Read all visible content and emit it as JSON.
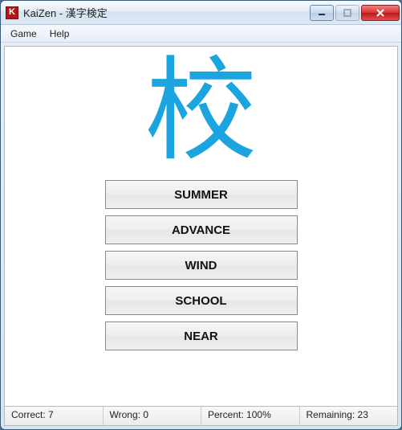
{
  "window": {
    "title": "KaiZen - 漢字検定",
    "app_icon_letter": "K"
  },
  "menu": {
    "game": "Game",
    "help": "Help"
  },
  "quiz": {
    "kanji": "校",
    "answers": [
      "SUMMER",
      "ADVANCE",
      "WIND",
      "SCHOOL",
      "NEAR"
    ]
  },
  "status": {
    "correct_label": "Correct:",
    "correct_value": "7",
    "wrong_label": "Wrong:",
    "wrong_value": "0",
    "percent_label": "Percent:",
    "percent_value": "100%",
    "remaining_label": "Remaining:",
    "remaining_value": "23"
  },
  "colors": {
    "kanji_color": "#1ba4e0",
    "close_red": "#c01818"
  }
}
